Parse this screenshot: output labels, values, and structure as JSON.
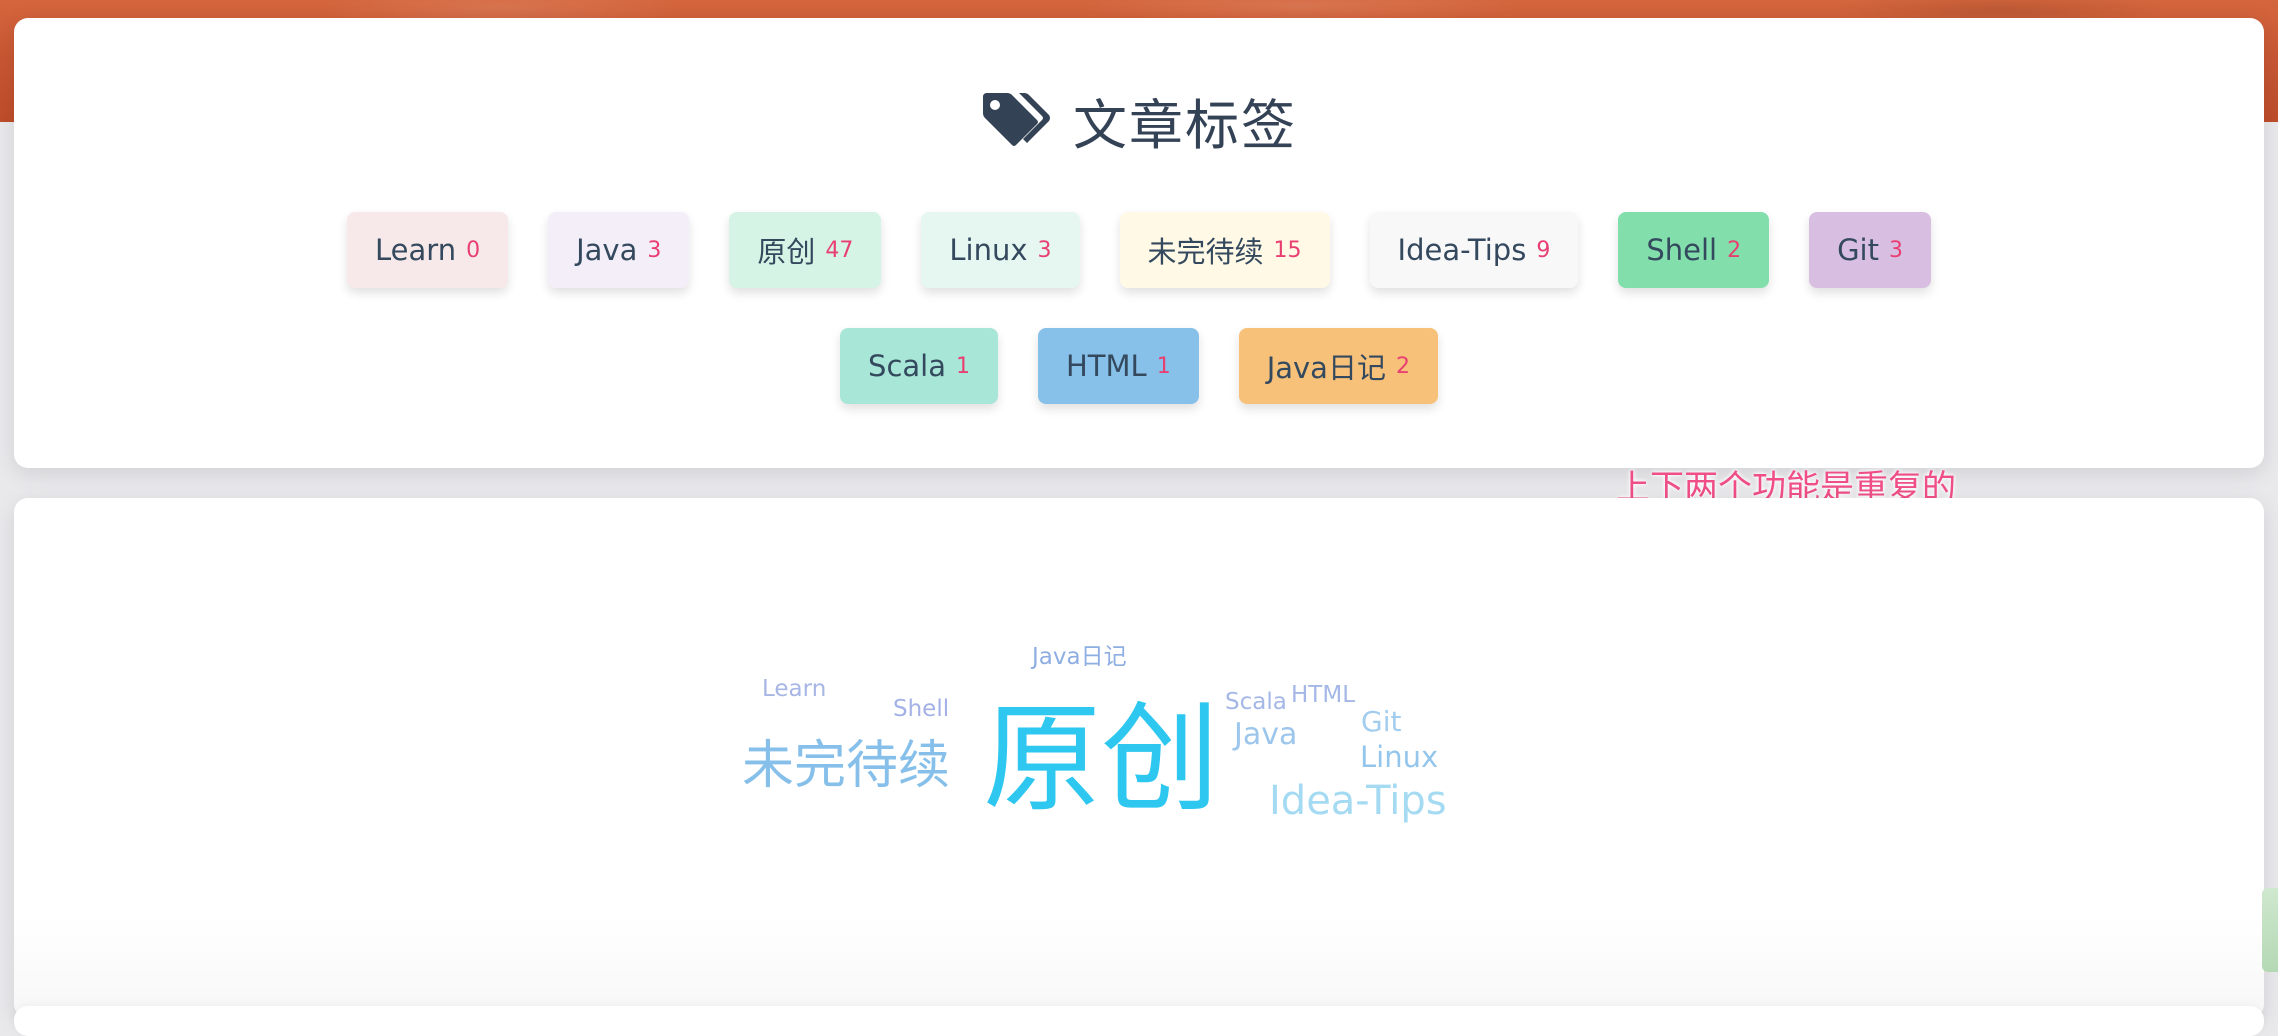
{
  "header": {
    "title": "文章标签",
    "icon": "tags-icon"
  },
  "tags": [
    {
      "name": "Learn",
      "count": "0",
      "color": "#f7e9e9"
    },
    {
      "name": "Java",
      "count": "3",
      "color": "#f4eef8"
    },
    {
      "name": "原创",
      "count": "47",
      "color": "#d5f4e5"
    },
    {
      "name": "Linux",
      "count": "3",
      "color": "#e6f7f2"
    },
    {
      "name": "未完待续",
      "count": "15",
      "color": "#fff9e6"
    },
    {
      "name": "Idea-Tips",
      "count": "9",
      "color": "#f8f8f9"
    },
    {
      "name": "Shell",
      "count": "2",
      "color": "#82dfab"
    },
    {
      "name": "Git",
      "count": "3",
      "color": "#d8bfe1"
    },
    {
      "name": "Scala",
      "count": "1",
      "color": "#a8e6d7"
    },
    {
      "name": "HTML",
      "count": "1",
      "color": "#87c1e9"
    },
    {
      "name": "Java日记",
      "count": "2",
      "color": "#f7c17a"
    }
  ],
  "annotation": "上下两个功能是重复的",
  "word_cloud": [
    {
      "text": "Java日记",
      "color": "#8eaee2"
    },
    {
      "text": "Learn",
      "color": "#a7b6e4"
    },
    {
      "text": "Shell",
      "color": "#a4b1e6"
    },
    {
      "text": "未完待续",
      "color": "#86c0ea"
    },
    {
      "text": "原创",
      "color": "#2ec7ef"
    },
    {
      "text": "Scala",
      "color": "#a4b7e6"
    },
    {
      "text": "HTML",
      "color": "#a4b7e6"
    },
    {
      "text": "Java",
      "color": "#9cc6ec"
    },
    {
      "text": "Git",
      "color": "#a3cdee"
    },
    {
      "text": "Linux",
      "color": "#94c6ec"
    },
    {
      "text": "Idea-Tips",
      "color": "#a4daf2"
    }
  ]
}
